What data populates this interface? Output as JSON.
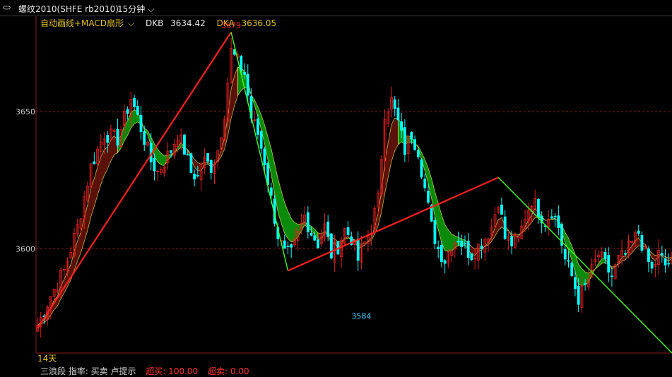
{
  "window": {
    "symbol_title": "螺纹2010(SHFE rb2010)",
    "period": "15分钟",
    "icon": "link-icon"
  },
  "indicator_bar": {
    "name": "自动画线+MACD扇形",
    "dkb_label": "DKB",
    "dkb_value": "3634.42",
    "dka_label": "DKA",
    "dka_value": "3636.05"
  },
  "bottom": {
    "days": "14天",
    "partial_text": "三浪段 指率: 买卖 卢提示",
    "partial_val1": "超买: 100.00",
    "partial_val2": "超卖: 0.00"
  },
  "colors": {
    "background": "#000000",
    "up_candle": "#e02020",
    "down_candle": "#00ffff",
    "fan_bull": "#5a1208",
    "fan_bear": "#0a8a0a",
    "fan_edge": "#ffff66",
    "trend_red": "#ff2020",
    "trend_green": "#40ff20",
    "price_label_red": "#ff3030",
    "price_label_cyan": "#40d0ff",
    "grid": "#8b1a1a"
  },
  "chart_data": {
    "type": "candlestick",
    "symbol": "螺纹2010(SHFE rb2010)",
    "period": "15分钟",
    "ylim": [
      3562,
      3683
    ],
    "y_ticks": [
      3600,
      3650
    ],
    "grid": "dashed horizontal at ticks",
    "peak_labels": [
      {
        "text": "3679",
        "value": 3679,
        "index": 58
      },
      {
        "text": "3584",
        "value": 3584,
        "index": 97
      }
    ],
    "trend_lines": [
      {
        "color": "red",
        "from": {
          "index": 0,
          "value": 3571
        },
        "to": {
          "index": 58,
          "value": 3679
        }
      },
      {
        "color": "green",
        "from": {
          "index": 58,
          "value": 3679
        },
        "to": {
          "index": 75,
          "value": 3592
        }
      },
      {
        "color": "red",
        "from": {
          "index": 75,
          "value": 3592
        },
        "to": {
          "index": 138,
          "value": 3626
        }
      },
      {
        "color": "green",
        "from": {
          "index": 138,
          "value": 3626
        },
        "to": {
          "index": 190,
          "value": 3562
        }
      }
    ],
    "close_path": [
      [
        0,
        3572
      ],
      [
        4,
        3583
      ],
      [
        8,
        3592
      ],
      [
        12,
        3608
      ],
      [
        16,
        3630
      ],
      [
        20,
        3642
      ],
      [
        24,
        3640
      ],
      [
        28,
        3655
      ],
      [
        30,
        3648
      ],
      [
        32,
        3640
      ],
      [
        34,
        3632
      ],
      [
        36,
        3628
      ],
      [
        38,
        3632
      ],
      [
        40,
        3636
      ],
      [
        42,
        3642
      ],
      [
        44,
        3636
      ],
      [
        46,
        3628
      ],
      [
        48,
        3626
      ],
      [
        50,
        3632
      ],
      [
        52,
        3630
      ],
      [
        54,
        3636
      ],
      [
        56,
        3650
      ],
      [
        58,
        3672
      ],
      [
        60,
        3668
      ],
      [
        62,
        3664
      ],
      [
        64,
        3648
      ],
      [
        66,
        3642
      ],
      [
        68,
        3632
      ],
      [
        70,
        3618
      ],
      [
        72,
        3605
      ],
      [
        74,
        3598
      ],
      [
        76,
        3598
      ],
      [
        78,
        3605
      ],
      [
        80,
        3612
      ],
      [
        82,
        3606
      ],
      [
        84,
        3602
      ],
      [
        86,
        3608
      ],
      [
        88,
        3598
      ],
      [
        90,
        3601
      ],
      [
        92,
        3607
      ],
      [
        94,
        3604
      ],
      [
        96,
        3596
      ],
      [
        98,
        3602
      ],
      [
        100,
        3608
      ],
      [
        102,
        3618
      ],
      [
        104,
        3650
      ],
      [
        106,
        3654
      ],
      [
        108,
        3646
      ],
      [
        110,
        3636
      ],
      [
        112,
        3642
      ],
      [
        114,
        3636
      ],
      [
        116,
        3622
      ],
      [
        118,
        3608
      ],
      [
        120,
        3600
      ],
      [
        122,
        3596
      ],
      [
        124,
        3602
      ],
      [
        126,
        3604
      ],
      [
        128,
        3600
      ],
      [
        130,
        3598
      ],
      [
        132,
        3601
      ],
      [
        134,
        3604
      ],
      [
        136,
        3608
      ],
      [
        138,
        3618
      ],
      [
        140,
        3604
      ],
      [
        142,
        3602
      ],
      [
        144,
        3603
      ],
      [
        146,
        3612
      ],
      [
        148,
        3618
      ],
      [
        150,
        3614
      ],
      [
        152,
        3610
      ],
      [
        154,
        3614
      ],
      [
        156,
        3608
      ],
      [
        158,
        3596
      ],
      [
        160,
        3590
      ],
      [
        162,
        3582
      ],
      [
        164,
        3586
      ],
      [
        166,
        3592
      ],
      [
        168,
        3598
      ],
      [
        170,
        3594
      ],
      [
        172,
        3590
      ],
      [
        174,
        3596
      ],
      [
        176,
        3598
      ],
      [
        178,
        3602
      ],
      [
        180,
        3606
      ],
      [
        182,
        3598
      ],
      [
        184,
        3592
      ],
      [
        186,
        3598
      ],
      [
        188,
        3594
      ],
      [
        190,
        3596
      ]
    ],
    "fan_bands": [
      {
        "from": 0,
        "to": 24,
        "trend": "bull"
      },
      {
        "from": 24,
        "to": 45,
        "trend": "bear"
      },
      {
        "from": 45,
        "to": 60,
        "trend": "bull"
      },
      {
        "from": 60,
        "to": 84,
        "trend": "bear"
      },
      {
        "from": 84,
        "to": 108,
        "trend": "bull"
      },
      {
        "from": 108,
        "to": 128,
        "trend": "bear"
      },
      {
        "from": 128,
        "to": 150,
        "trend": "bull"
      },
      {
        "from": 150,
        "to": 170,
        "trend": "bear"
      },
      {
        "from": 170,
        "to": 190,
        "trend": "bull"
      }
    ]
  }
}
